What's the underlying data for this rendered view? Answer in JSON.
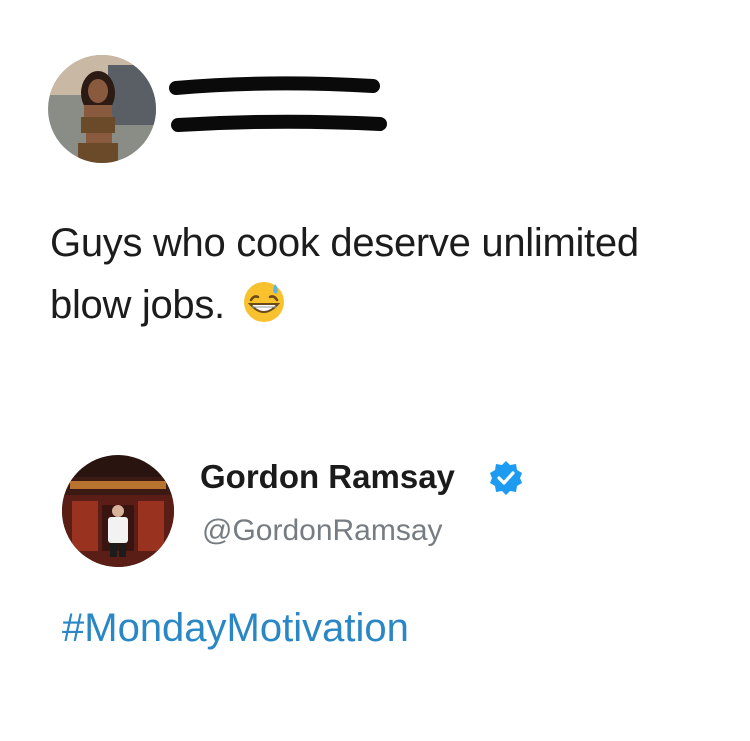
{
  "first_tweet": {
    "avatar_icon": "user-avatar-photo",
    "name_redacted": true,
    "text": "Guys who cook deserve unlimited",
    "text_line2": "blow jobs.",
    "emoji": "grinning-face-with-sweat-icon"
  },
  "reply_tweet": {
    "avatar_icon": "restaurant-avatar-photo",
    "display_name": "Gordon Ramsay",
    "verified_icon": "verified-badge-icon",
    "handle": "@GordonRamsay",
    "hashtag": "#MondayMotivation"
  },
  "colors": {
    "text": "#1c1c1c",
    "handle": "#767c82",
    "link": "#2a87c6",
    "verified": "#1d9bf0"
  }
}
